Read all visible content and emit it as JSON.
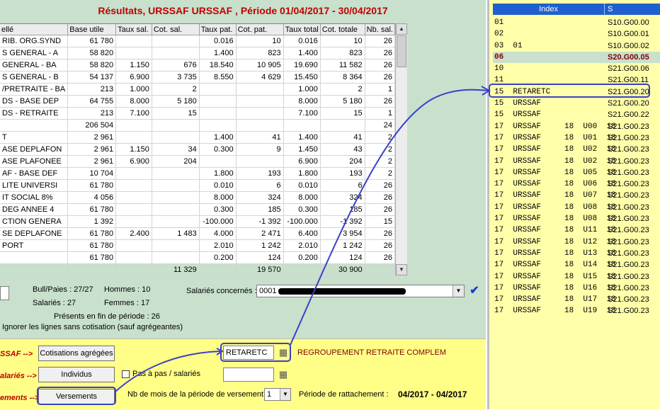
{
  "title": "Résultats, URSSAF URSSAF , Période 01/04/2017 - 30/04/2017",
  "grid": {
    "headers": [
      "ellé",
      "Base utile",
      "Taux sal.",
      "Cot. sal.",
      "Taux pat.",
      "Cot. pat.",
      "Taux total",
      "Cot. totale",
      "Nb. sal."
    ],
    "rows": [
      [
        "RIB. ORG.SYND",
        "61 780",
        "",
        "",
        "0.016",
        "10",
        "0.016",
        "10",
        "26"
      ],
      [
        "S GENERAL - A",
        "58 820",
        "",
        "",
        "1.400",
        "823",
        "1.400",
        "823",
        "26"
      ],
      [
        "GENERAL - BA",
        "58 820",
        "1.150",
        "676",
        "18.540",
        "10 905",
        "19.690",
        "11 582",
        "26"
      ],
      [
        "S GENERAL - B",
        "54 137",
        "6.900",
        "3 735",
        "8.550",
        "4 629",
        "15.450",
        "8 364",
        "26"
      ],
      [
        "/PRETRAITE - BA",
        "213",
        "1.000",
        "2",
        "",
        "",
        "1.000",
        "2",
        "1"
      ],
      [
        "DS - BASE DEP",
        "64 755",
        "8.000",
        "5 180",
        "",
        "",
        "8.000",
        "5 180",
        "26"
      ],
      [
        "DS - RETRAITE",
        "213",
        "7.100",
        "15",
        "",
        "",
        "7.100",
        "15",
        "1"
      ],
      [
        "",
        "206 504",
        "",
        "",
        "",
        "",
        "",
        "",
        "24"
      ],
      [
        "T",
        "2 961",
        "",
        "",
        "1.400",
        "41",
        "1.400",
        "41",
        "2"
      ],
      [
        "ASE DEPLAFON",
        "2 961",
        "1.150",
        "34",
        "0.300",
        "9",
        "1.450",
        "43",
        "2"
      ],
      [
        "ASE PLAFONEE",
        "2 961",
        "6.900",
        "204",
        "",
        "",
        "6.900",
        "204",
        "2"
      ],
      [
        "AF - BASE DEF",
        "10 704",
        "",
        "",
        "1.800",
        "193",
        "1.800",
        "193",
        "2"
      ],
      [
        "LITE UNIVERSI",
        "61 780",
        "",
        "",
        "0.010",
        "6",
        "0.010",
        "6",
        "26"
      ],
      [
        "IT SOCIAL 8%",
        "4 056",
        "",
        "",
        "8.000",
        "324",
        "8.000",
        "324",
        "26"
      ],
      [
        "DEG ANNEE 4",
        "61 780",
        "",
        "",
        "0.300",
        "185",
        "0.300",
        "185",
        "26"
      ],
      [
        "CTION GENERA",
        "1 392",
        "",
        "",
        "-100.000",
        "-1 392",
        "-100.000",
        "-1 392",
        "15"
      ],
      [
        "SE DEPLAFONE",
        "61 780",
        "2.400",
        "1 483",
        "4.000",
        "2 471",
        "6.400",
        "3 954",
        "26"
      ],
      [
        "PORT",
        "61 780",
        "",
        "",
        "2.010",
        "1 242",
        "2.010",
        "1 242",
        "26"
      ],
      [
        "",
        "61 780",
        "",
        "",
        "0.200",
        "124",
        "0.200",
        "124",
        "26"
      ]
    ],
    "totals": [
      "",
      "",
      "",
      "11 329",
      "",
      "19 570",
      "",
      "30 900",
      ""
    ]
  },
  "info": {
    "bull_paies": "Bull/Paies : 27/27",
    "hommes": "Hommes : 10",
    "salaries": "Salariés : 27",
    "femmes": "Femmes : 17",
    "presents": "Présents en fin de période : 26",
    "ignorer": "Ignorer les lignes sans cotisation (sauf agrégeantes)",
    "salaries_concernes_label": "Salariés concernés :",
    "salaries_concernes_value": "0001"
  },
  "bottom": {
    "label_urssaf": "SSAF -->",
    "label_salaries": "alariés -->",
    "label_versements": "ements -->",
    "btn_cotisations": "Cotisations agrégées",
    "btn_individus": "Individus",
    "btn_versements": "Versements",
    "input_regroupement": "RETARETC",
    "regroupement_desc": "REGROUPEMENT RETRAITE COMPLEM",
    "pas_a_pas": "Pas à pas / salariés",
    "input_salarie": "",
    "nb_mois_label": "Nb de mois de la période de versement :",
    "nb_mois_value": "1",
    "periode_label": "Période de rattachement :",
    "periode_value": "04/2017 - 04/2017"
  },
  "index_panel": {
    "header_index": "Index",
    "header_s": "S",
    "rows": [
      {
        "idx": "01",
        "code": "S10.G00.00"
      },
      {
        "idx": "02",
        "code": "S10.G00.01"
      },
      {
        "idx": "03  01",
        "code": "S10.G00.02"
      },
      {
        "idx": "06",
        "code": "S20.G00.05"
      },
      {
        "idx": "10",
        "code": "S21.G00.06"
      },
      {
        "idx": "11",
        "code": "S21.G00.11"
      },
      {
        "idx": "15  RETARETC",
        "code": "S21.G00.20"
      },
      {
        "idx": "15  URSSAF",
        "code": "S21.G00.20"
      },
      {
        "idx": "15  URSSAF",
        "code": "S21.G00.22"
      },
      {
        "idx": "17  URSSAF     18  U00  18",
        "code": "S21.G00.23"
      },
      {
        "idx": "17  URSSAF     18  U01  18",
        "code": "S21.G00.23"
      },
      {
        "idx": "17  URSSAF     18  U02  18",
        "code": "S21.G00.23"
      },
      {
        "idx": "17  URSSAF     18  U02  18",
        "code": "S21.G00.23"
      },
      {
        "idx": "17  URSSAF     18  U05  18",
        "code": "S21.G00.23"
      },
      {
        "idx": "17  URSSAF     18  U06  18",
        "code": "S21.G00.23"
      },
      {
        "idx": "17  URSSAF     18  U07  18",
        "code": "S21.G00.23"
      },
      {
        "idx": "17  URSSAF     18  U08  18",
        "code": "S21.G00.23"
      },
      {
        "idx": "17  URSSAF     18  U08  18",
        "code": "S21.G00.23"
      },
      {
        "idx": "17  URSSAF     18  U11  18",
        "code": "S21.G00.23"
      },
      {
        "idx": "17  URSSAF     18  U12  18",
        "code": "S21.G00.23"
      },
      {
        "idx": "17  URSSAF     18  U13  18",
        "code": "S21.G00.23"
      },
      {
        "idx": "17  URSSAF     18  U14  18",
        "code": "S21.G00.23"
      },
      {
        "idx": "17  URSSAF     18  U15  18",
        "code": "S21.G00.23"
      },
      {
        "idx": "17  URSSAF     18  U16  18",
        "code": "S21.G00.23"
      },
      {
        "idx": "17  URSSAF     18  U17  18",
        "code": "S21.G00.23"
      },
      {
        "idx": "17  URSSAF     18  U19  18",
        "code": "S21.G00.23"
      }
    ],
    "highlighted_row": 3
  },
  "colors": {
    "title_red": "#c00000",
    "panel_green": "#c8e0cc",
    "yellow_zone": "#ffff88",
    "index_yellow": "#ffffaa",
    "header_blue": "#1f5fcf",
    "annotation_blue": "#3a40c8"
  },
  "icons": {
    "table_button": "table-icon",
    "validate": "check-arrow-icon",
    "dropdown": "chevron-down-icon"
  }
}
